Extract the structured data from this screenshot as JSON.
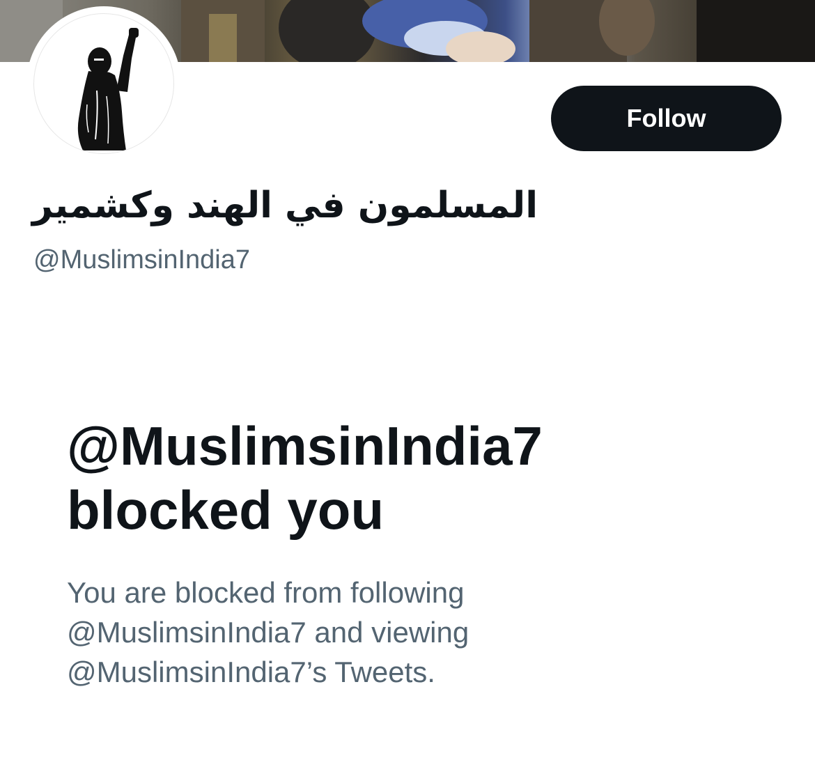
{
  "profile": {
    "display_name": "المسلمون في الهند وكشمير",
    "handle": "@MuslimsinIndia7"
  },
  "actions": {
    "follow_label": "Follow"
  },
  "blocked": {
    "title_handle": "@MuslimsinIndia7",
    "title_suffix": "blocked you",
    "desc_line1": "You are blocked from following",
    "desc_line2": "@MuslimsinIndia7 and viewing",
    "desc_line3": "@MuslimsinIndia7’s Tweets."
  },
  "icons": {
    "avatar": "raised-fist-woman-avatar"
  },
  "colors": {
    "primary_text": "#0f1419",
    "secondary_text": "#536471",
    "button_bg": "#0f1419",
    "button_text": "#ffffff",
    "background": "#ffffff"
  }
}
